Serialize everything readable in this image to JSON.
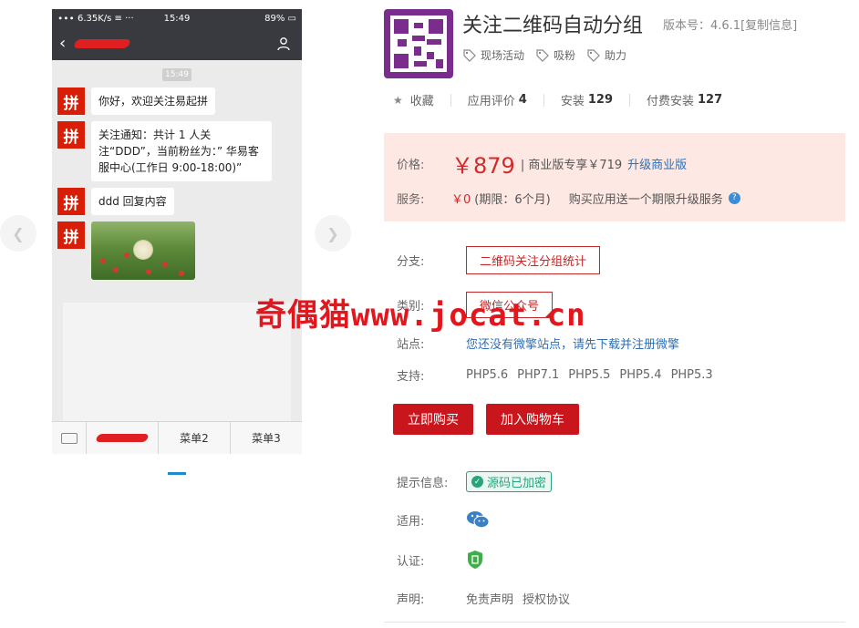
{
  "gallery": {
    "phone": {
      "status": {
        "left": "∙∙∙ 6.35K/s ≡ ···",
        "time": "15:49",
        "battery": "89% ▭"
      },
      "chat_time": "15:49",
      "avatar_char": "拼",
      "messages": [
        "你好，欢迎关注易起拼",
        "关注通知：共计 1 人关注“DDD”，当前粉丝为：” 华易客服中心(工作日 9:00-18:00)”",
        "ddd 回复内容"
      ],
      "menu": [
        "菜单2",
        "菜单3"
      ]
    }
  },
  "app": {
    "title": "关注二维码自动分组",
    "version": "版本号：4.6.1[复制信息]",
    "tags": [
      "现场活动",
      "吸粉",
      "助力"
    ]
  },
  "stats": {
    "favorite": "收藏",
    "rating_label": "应用评价",
    "rating_value": "4",
    "install_label": "安装",
    "install_value": "129",
    "paid_label": "付费安装",
    "paid_value": "127"
  },
  "pricing": {
    "price_label": "价格:",
    "price": "￥879",
    "business": "| 商业版专享￥719",
    "upgrade": "升级商业版",
    "service_label": "服务:",
    "service_price": "￥0",
    "service_period": "(期限：6个月)",
    "service_note": "购买应用送一个期限升级服务"
  },
  "branch": {
    "label": "分支:",
    "value": "二维码关注分组统计"
  },
  "category": {
    "label": "类别:",
    "value": "微信公众号"
  },
  "site": {
    "label": "站点:",
    "value": "您还没有微擎站点，请先下载并注册微擎"
  },
  "support": {
    "label": "支持:",
    "versions": [
      "PHP5.6",
      "PHP7.1",
      "PHP5.5",
      "PHP5.4",
      "PHP5.3"
    ]
  },
  "actions": {
    "buy": "立即购买",
    "cart": "加入购物车"
  },
  "info": {
    "hint_label": "提示信息:",
    "encrypted": "源码已加密",
    "apply_label": "适用:",
    "cert_label": "认证:",
    "declare_label": "声明:",
    "disclaimer": "免责声明",
    "license": "授权协议"
  },
  "watermark": "奇偶猫www.jocat.cn",
  "colors": {
    "accent": "#c9161d",
    "link": "#2f6fb4",
    "price_bg": "#fde8e3",
    "logo": "#7b2d8e"
  },
  "icons": [
    "chevron-left-icon",
    "chevron-right-icon",
    "back-icon",
    "user-icon",
    "keyboard-icon",
    "tag-icon",
    "star-icon",
    "help-icon",
    "check-icon",
    "wechat-icon",
    "shield-icon"
  ]
}
